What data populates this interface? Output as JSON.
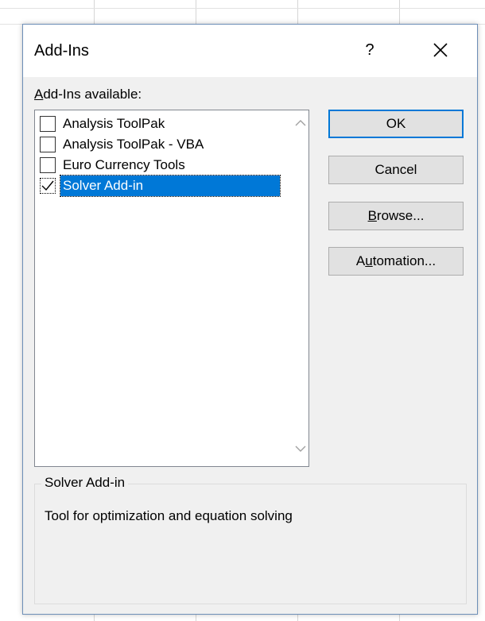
{
  "dialog": {
    "title": "Add-Ins",
    "help_label": "?",
    "close_icon": "close-icon"
  },
  "list": {
    "label_accel": "A",
    "label_rest": "dd-Ins available:",
    "items": [
      {
        "label": "Analysis ToolPak",
        "checked": false,
        "selected": false
      },
      {
        "label": "Analysis ToolPak - VBA",
        "checked": false,
        "selected": false
      },
      {
        "label": "Euro Currency Tools",
        "checked": false,
        "selected": false
      },
      {
        "label": "Solver Add-in",
        "checked": true,
        "selected": true
      }
    ]
  },
  "buttons": {
    "ok": "OK",
    "cancel": "Cancel",
    "browse_accel": "B",
    "browse_rest": "rowse...",
    "automation_pre": "A",
    "automation_accel": "u",
    "automation_rest": "tomation..."
  },
  "description": {
    "group_title": "Solver Add-in",
    "text": "Tool for optimization and equation solving"
  },
  "colors": {
    "selection": "#0078d7",
    "dialog_bg": "#f0f0f0",
    "default_button_border": "#0078d7"
  }
}
